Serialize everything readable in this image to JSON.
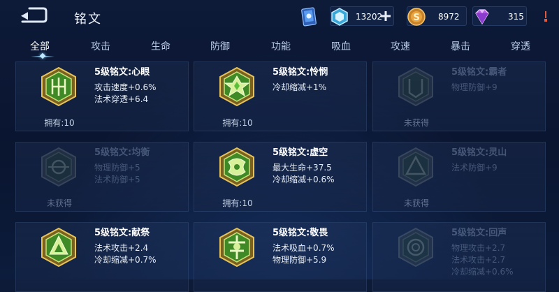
{
  "header": {
    "title": "铭文",
    "currencies": {
      "crystal": "13202",
      "gold": "8972",
      "diamond": "315"
    }
  },
  "tabs": [
    {
      "label": "全部",
      "active": true
    },
    {
      "label": "攻击",
      "active": false
    },
    {
      "label": "生命",
      "active": false
    },
    {
      "label": "防御",
      "active": false
    },
    {
      "label": "功能",
      "active": false
    },
    {
      "label": "吸血",
      "active": false
    },
    {
      "label": "攻速",
      "active": false
    },
    {
      "label": "暴击",
      "active": false
    },
    {
      "label": "穿透",
      "active": false
    }
  ],
  "inscriptions": [
    {
      "name": "5级铭文:心眼",
      "stats": [
        "攻击速度+0.6%",
        "法术穿透+6.4"
      ],
      "status": "拥有:10",
      "owned": true,
      "emblem": "heart-eye"
    },
    {
      "name": "5级铭文:怜悯",
      "stats": [
        "冷却缩减+1%"
      ],
      "status": "拥有:10",
      "owned": true,
      "emblem": "star"
    },
    {
      "name": "5级铭文:霸者",
      "stats": [
        "物理防御+9"
      ],
      "status": "未获得",
      "owned": false,
      "emblem": "overlord"
    },
    {
      "name": "5级铭文:均衡",
      "stats": [
        "物理防御+5",
        "法术防御+5"
      ],
      "status": "未获得",
      "owned": false,
      "emblem": "balance"
    },
    {
      "name": "5级铭文:虚空",
      "stats": [
        "最大生命+37.5",
        "冷却缩减+0.6%"
      ],
      "status": "拥有:10",
      "owned": true,
      "emblem": "void"
    },
    {
      "name": "5级铭文:灵山",
      "stats": [
        "法术防御+9"
      ],
      "status": "未获得",
      "owned": false,
      "emblem": "mountain"
    },
    {
      "name": "5级铭文:献祭",
      "stats": [
        "法术攻击+2.4",
        "冷却缩减+0.7%"
      ],
      "status": "",
      "owned": true,
      "emblem": "sacrifice"
    },
    {
      "name": "5级铭文:敬畏",
      "stats": [
        "法术吸血+0.7%",
        "物理防御+5.9"
      ],
      "status": "",
      "owned": true,
      "emblem": "awe"
    },
    {
      "name": "5级铭文:回声",
      "stats": [
        "物理攻击+2.7",
        "法术攻击+2.7",
        "冷却缩减+0.6%"
      ],
      "status": "",
      "owned": false,
      "emblem": "echo"
    }
  ],
  "colors": {
    "background": "#0b1733",
    "tab_active": "#ffffff",
    "tab_inactive": "#b9cbe6",
    "emblem_gold": "#c9a43c",
    "emblem_green": "#5bbf3a"
  }
}
